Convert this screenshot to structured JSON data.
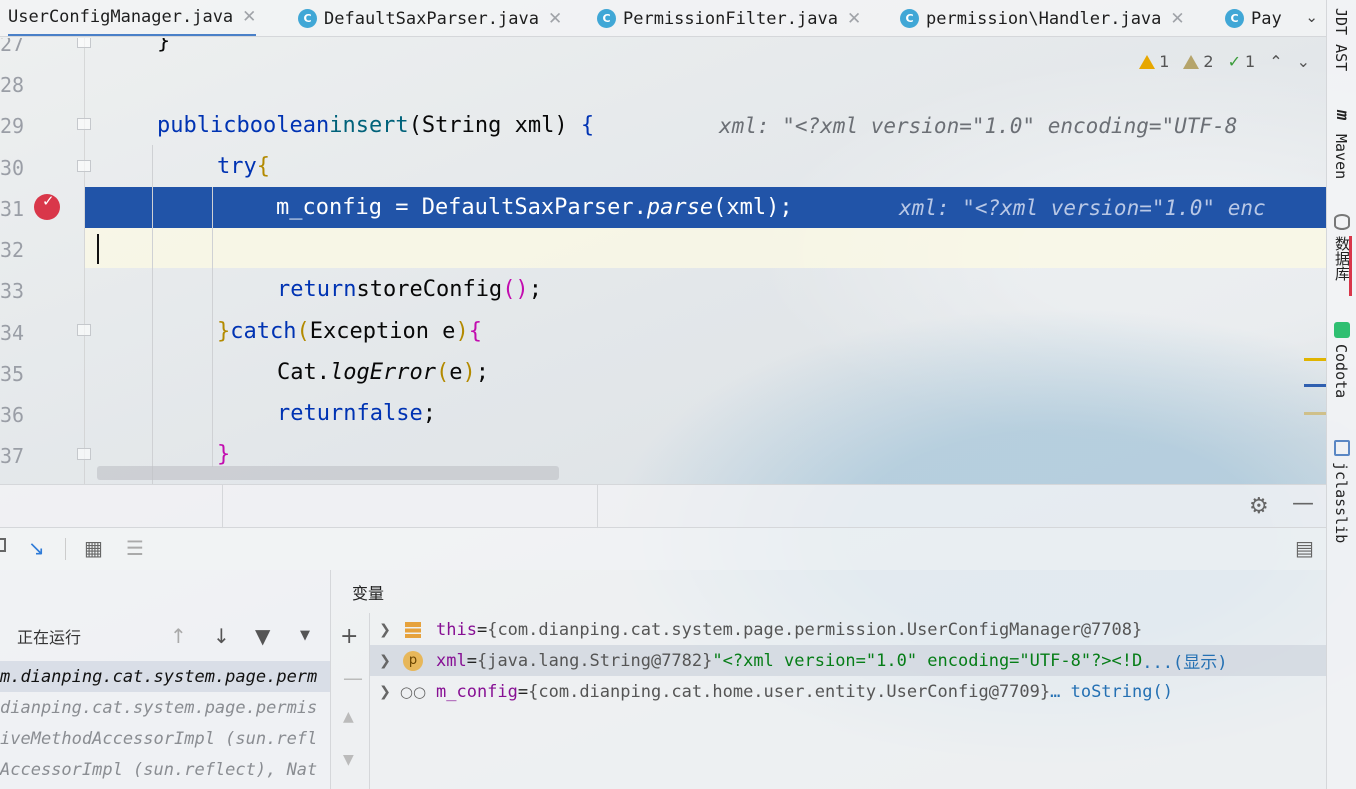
{
  "tabs": [
    {
      "label": "UserConfigManager.java",
      "active": true
    },
    {
      "label": "DefaultSaxParser.java"
    },
    {
      "label": "PermissionFilter.java"
    },
    {
      "label": "permission\\Handler.java"
    },
    {
      "label": "Pay"
    }
  ],
  "right_tools": {
    "jdt": "JDT AST",
    "maven": "Maven",
    "database": "数据库",
    "codota": "Codota",
    "jclasslib": "jclasslib"
  },
  "inspections": {
    "warnings": "1",
    "weak_warnings": "2",
    "ok": "1"
  },
  "editor": {
    "line_numbers": [
      "27",
      "28",
      "29",
      "30",
      "31",
      "32",
      "33",
      "34",
      "35",
      "36",
      "37"
    ],
    "hint_xml": "xml: \"<?xml version=\"1.0\" encoding=\"UTF-8",
    "hint_xml_exec": "xml: \"<?xml version=\"1.0\" enc",
    "tokens": {
      "close_brace": "}",
      "public": "public",
      "boolean": "boolean",
      "insert": "insert",
      "sig_params": "(String xml) ",
      "open_brace": "{",
      "try": "try",
      "exec_code": "m_config = DefaultSaxParser.",
      "parse": "parse",
      "exec_tail": "(xml);",
      "return": "return",
      "store": "storeConfig",
      "parens": "()",
      "semi": ";",
      "catch": "catch",
      "catch_open": "(",
      "catch_body": "Exception e",
      "catch_close": ")",
      "cat": "Cat.",
      "logerror": "logError",
      "logerror_open": "(",
      "logerror_arg": "e",
      "logerror_close": ")",
      "false": "false"
    }
  },
  "debugger": {
    "status": "正在运行",
    "frames": [
      "m.dianping.cat.system.page.perm",
      "dianping.cat.system.page.permis",
      "iveMethodAccessorImpl (sun.refl",
      "AccessorImpl (sun.reflect), Nat"
    ],
    "variables_title": "变量",
    "variables": [
      {
        "name": "this",
        "eq": " = ",
        "value": "{com.dianping.cat.system.page.permission.UserConfigManager@7708}"
      },
      {
        "name": "xml",
        "eq": " = ",
        "value": "{java.lang.String@7782} ",
        "str": "\"<?xml version=\"1.0\" encoding=\"UTF-8\"?><!D",
        "more": "...(显示)"
      },
      {
        "name": "m_config",
        "eq": " = ",
        "value": "{com.dianping.cat.home.user.entity.UserConfig@7709} ",
        "link": "… toString()"
      }
    ]
  },
  "colors": {
    "exec_line": "#2154a8",
    "keyword": "#0033b3",
    "breakpoint": "#d9374a",
    "string": "#067d17"
  }
}
